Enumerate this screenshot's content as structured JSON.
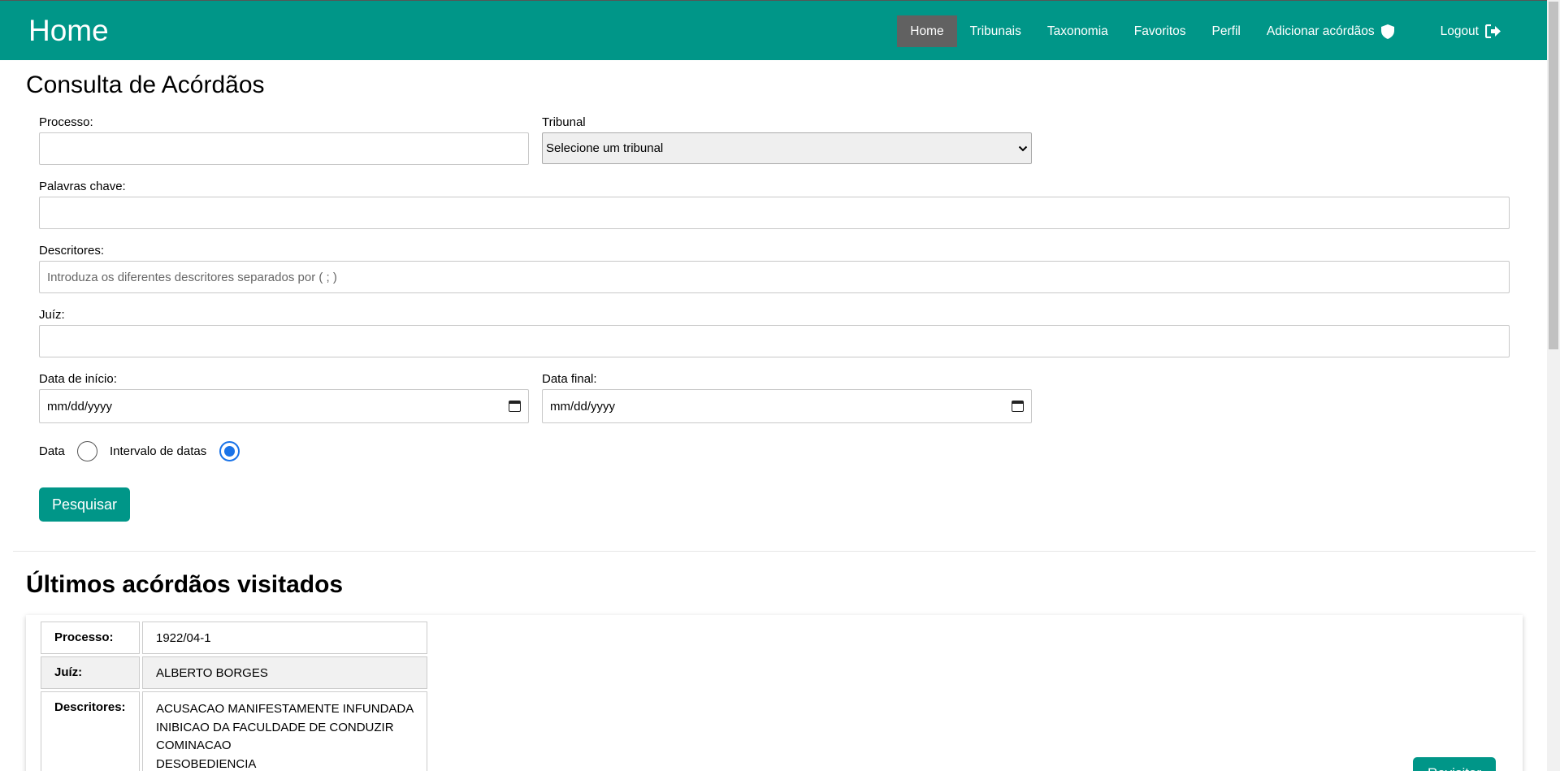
{
  "nav": {
    "brand": "Home",
    "items": [
      "Home",
      "Tribunais",
      "Taxonomia",
      "Favoritos",
      "Perfil",
      "Adicionar acórdãos",
      "Logout"
    ],
    "active": "Home"
  },
  "search": {
    "title": "Consulta de Acórdãos",
    "processo_label": "Processo:",
    "tribunal_label": "Tribunal",
    "tribunal_selected": "Selecione um tribunal",
    "palavras_label": "Palavras chave:",
    "descritores_label": "Descritores:",
    "descritores_placeholder": "Introduza os diferentes descritores separados por ( ; )",
    "juiz_label": "Juíz:",
    "data_inicio_label": "Data de início:",
    "data_final_label": "Data final:",
    "date_placeholder": "mm/dd/yyyy",
    "radio_data": "Data",
    "radio_intervalo": "Intervalo de datas",
    "selected_mode": "Intervalo de datas",
    "submit": "Pesquisar"
  },
  "recent": {
    "title": "Últimos acórdãos visitados",
    "processo_key": "Processo:",
    "processo_value": "1922/04-1",
    "juiz_key": "Juíz:",
    "juiz_value": "ALBERTO BORGES",
    "descritores_key": "Descritores:",
    "descritores": [
      "ACUSACAO MANIFESTAMENTE INFUNDADA",
      "INIBICAO DA FACULDADE DE CONDUZIR",
      "COMINACAO",
      "DESOBEDIENCIA"
    ],
    "button_partial": "Revisitar"
  },
  "colors": {
    "primary": "#009688",
    "active_nav": "#616161",
    "radio": "#1a73e8"
  }
}
